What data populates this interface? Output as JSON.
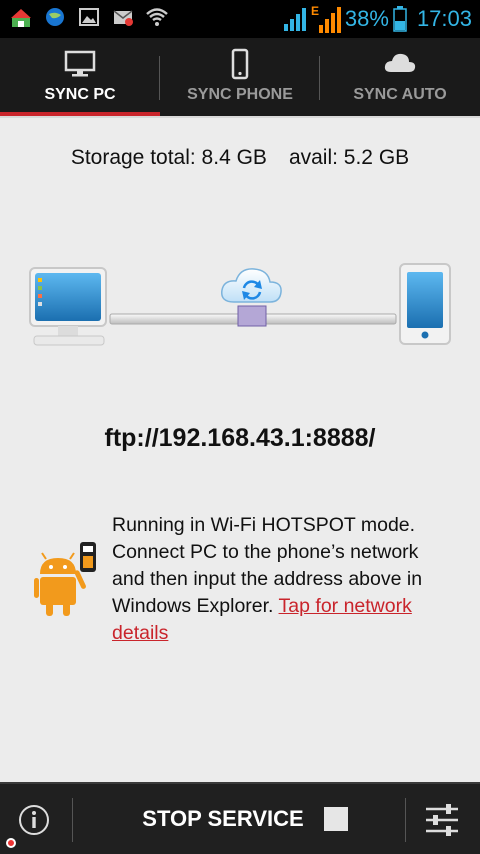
{
  "status_bar": {
    "battery_percent": "38%",
    "time": "17:03",
    "network_label": "E",
    "icons": [
      "home-icon",
      "globe-icon",
      "gallery-icon",
      "mail-icon",
      "wifi-icon",
      "signal-icon",
      "signal-e-icon",
      "battery-icon"
    ]
  },
  "tabs": [
    {
      "label": "SYNC PC",
      "icon": "monitor-icon",
      "active": true
    },
    {
      "label": "SYNC PHONE",
      "icon": "phone-icon",
      "active": false
    },
    {
      "label": "SYNC AUTO",
      "icon": "cloud-icon",
      "active": false
    }
  ],
  "storage": {
    "total_text": "Storage total: 8.4 GB",
    "avail_text": "avail: 5.2 GB"
  },
  "diagram": {
    "left": "computer-icon",
    "center": "cloud-sync-icon",
    "right": "phone-icon"
  },
  "ftp_address": "ftp://192.168.43.1:8888/",
  "info": {
    "text": "Running in Wi-Fi HOTSPOT mode. Connect PC to the phone’s network and then input the address above in Windows Explorer. ",
    "link_text": "Tap for network details",
    "icon": "android-usb-icon"
  },
  "bottom_bar": {
    "stop_label": "STOP SERVICE",
    "info_icon": "info-icon",
    "settings_icon": "settings-sliders-icon"
  },
  "colors": {
    "accent": "#c9242b",
    "statusbar_text": "#33b5e5",
    "tabbar_bg": "#1a1a1a",
    "android_orange": "#f29a1c"
  }
}
